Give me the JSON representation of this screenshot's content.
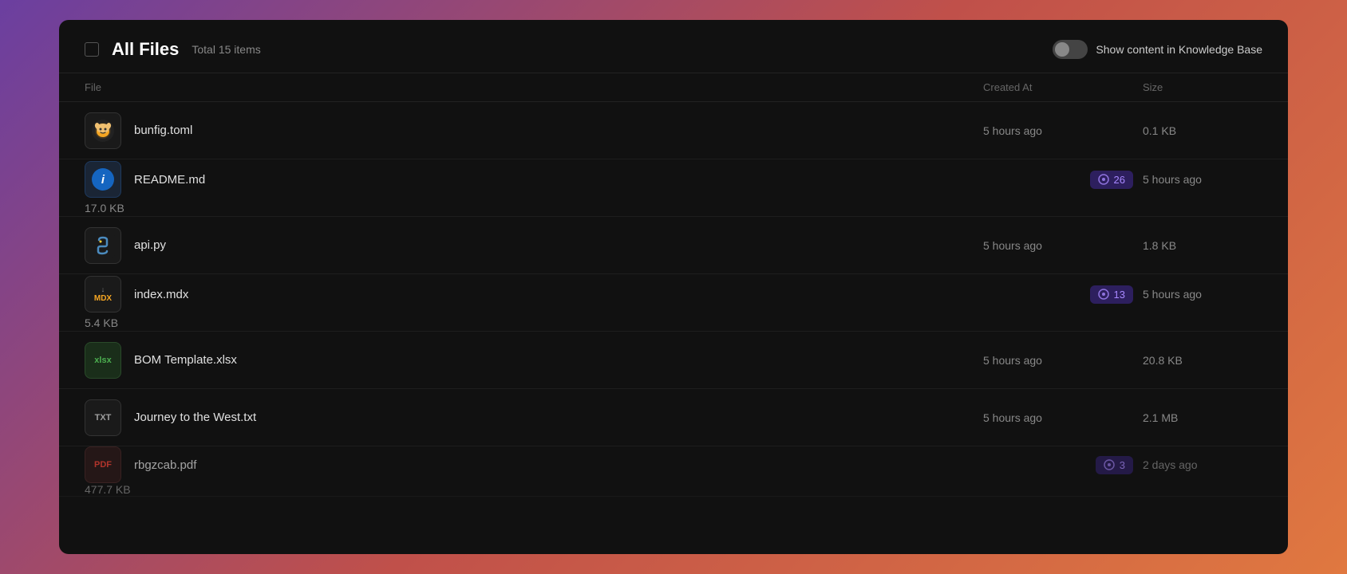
{
  "modal": {
    "title": "All Files",
    "total_items_label": "Total 15 items",
    "toggle_label": "Show content in Knowledge Base",
    "toggle_enabled": false
  },
  "table": {
    "headers": {
      "file": "File",
      "created_at": "Created At",
      "size": "Size"
    },
    "rows": [
      {
        "id": 1,
        "name": "bunfig.toml",
        "type": "toml",
        "icon_type": "bun",
        "badge": null,
        "created_at": "5 hours ago",
        "size": "0.1 KB"
      },
      {
        "id": 2,
        "name": "README.md",
        "type": "md",
        "icon_type": "info",
        "badge": {
          "count": 26
        },
        "created_at": "5 hours ago",
        "size": "17.0 KB"
      },
      {
        "id": 3,
        "name": "api.py",
        "type": "py",
        "icon_type": "python",
        "badge": null,
        "created_at": "5 hours ago",
        "size": "1.8 KB"
      },
      {
        "id": 4,
        "name": "index.mdx",
        "type": "mdx",
        "icon_type": "mdx",
        "badge": {
          "count": 13
        },
        "created_at": "5 hours ago",
        "size": "5.4 KB"
      },
      {
        "id": 5,
        "name": "BOM Template.xlsx",
        "type": "xlsx",
        "icon_type": "xlsx",
        "badge": null,
        "created_at": "5 hours ago",
        "size": "20.8 KB"
      },
      {
        "id": 6,
        "name": "Journey to the West.txt",
        "type": "txt",
        "icon_type": "txt",
        "badge": null,
        "created_at": "5 hours ago",
        "size": "2.1 MB"
      },
      {
        "id": 7,
        "name": "rbgzcab.pdf",
        "type": "pdf",
        "icon_type": "pdf",
        "badge": {
          "count": 3
        },
        "created_at": "2 days ago",
        "size": "477.7 KB"
      }
    ]
  }
}
